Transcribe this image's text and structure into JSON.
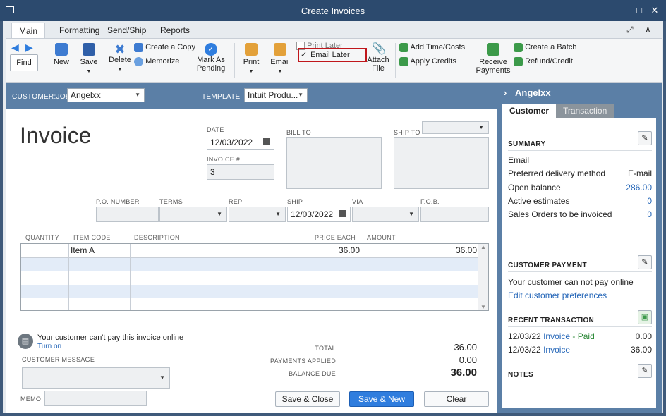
{
  "window": {
    "title": "Create Invoices"
  },
  "ribbon_tabs": [
    "Main",
    "Formatting",
    "Send/Ship",
    "Reports"
  ],
  "toolbar": {
    "find": "Find",
    "new": "New",
    "save": "Save",
    "delete": "Delete",
    "create_copy": "Create a Copy",
    "memorize": "Memorize",
    "mark_pending_1": "Mark As",
    "mark_pending_2": "Pending",
    "print": "Print",
    "email": "Email",
    "print_later": "Print Later",
    "email_later": "Email Later",
    "attach_1": "Attach",
    "attach_2": "File",
    "add_time": "Add Time/Costs",
    "apply_credits": "Apply Credits",
    "receive_1": "Receive",
    "receive_2": "Payments",
    "create_batch": "Create a Batch",
    "refund": "Refund/Credit"
  },
  "header": {
    "customer_job_label": "CUSTOMER:JOB",
    "customer_job_value": "Angelxx",
    "template_label": "TEMPLATE",
    "template_value": "Intuit Produ..."
  },
  "form": {
    "title": "Invoice",
    "date_label": "DATE",
    "date_value": "12/03/2022",
    "invoice_no_label": "INVOICE #",
    "invoice_no_value": "3",
    "bill_to_label": "BILL TO",
    "ship_to_label": "SHIP TO",
    "po_label": "P.O. NUMBER",
    "terms_label": "TERMS",
    "rep_label": "REP",
    "ship_label": "SHIP",
    "ship_value": "12/03/2022",
    "via_label": "VIA",
    "fob_label": "F.O.B."
  },
  "grid": {
    "columns": [
      "QUANTITY",
      "ITEM CODE",
      "DESCRIPTION",
      "PRICE EACH",
      "AMOUNT"
    ],
    "rows": [
      {
        "quantity": "",
        "item": "Item A",
        "description": "",
        "price": "36.00",
        "amount": "36.00"
      }
    ]
  },
  "footer": {
    "online_msg": "Your customer can't pay this invoice online",
    "turn_on": "Turn on",
    "customer_message_label": "CUSTOMER MESSAGE",
    "memo_label": "MEMO",
    "total_label": "TOTAL",
    "total_value": "36.00",
    "payments_label": "PAYMENTS APPLIED",
    "payments_value": "0.00",
    "balance_label": "BALANCE DUE",
    "balance_value": "36.00",
    "save_close": "Save & Close",
    "save_new": "Save & New",
    "clear": "Clear"
  },
  "panel": {
    "name": "Angelxx",
    "tab_customer": "Customer",
    "tab_transaction": "Transaction",
    "summary_title": "SUMMARY",
    "summary": [
      {
        "label": "Email",
        "value": ""
      },
      {
        "label": "Preferred delivery method",
        "value": "E-mail"
      },
      {
        "label": "Open balance",
        "value": "286.00"
      },
      {
        "label": "Active estimates",
        "value": "0"
      },
      {
        "label": "Sales Orders to be invoiced",
        "value": "0"
      }
    ],
    "payment_title": "CUSTOMER PAYMENT",
    "payment_text": "Your customer can not pay online",
    "payment_link": "Edit customer preferences",
    "recent_title": "RECENT TRANSACTION",
    "recent": [
      {
        "date": "12/03/22",
        "type": "Invoice",
        "status": " - Paid",
        "amount": "0.00"
      },
      {
        "date": "12/03/22",
        "type": "Invoice",
        "status": "",
        "amount": "36.00"
      }
    ],
    "notes_title": "NOTES"
  },
  "colors": {
    "accent": "#2f7dde",
    "header_band": "#5b7fa6",
    "highlight_box": "#c0171c",
    "row_alt": "#e3ecf8"
  }
}
